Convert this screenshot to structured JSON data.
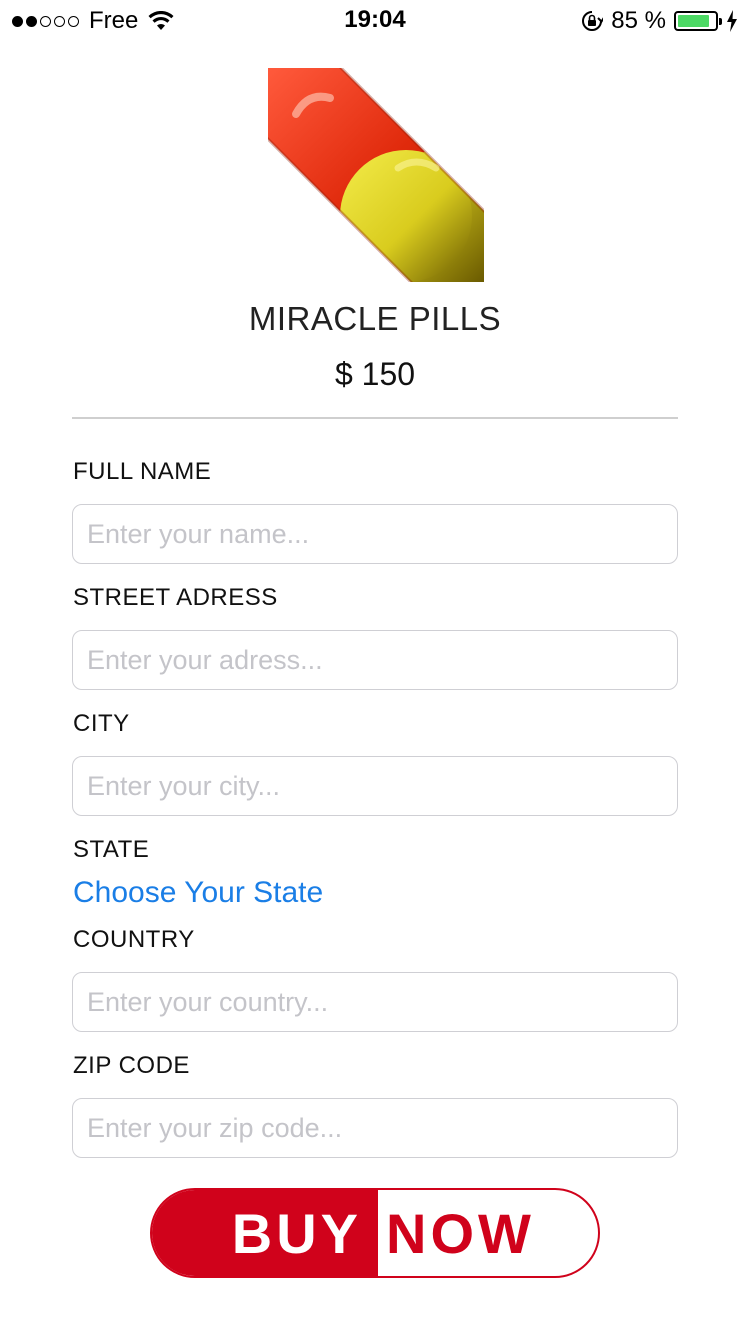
{
  "status_bar": {
    "carrier": "Free",
    "time": "19:04",
    "battery_percent": "85 %",
    "battery_level": 0.85,
    "signal_bars_filled": 2,
    "signal_bars_total": 5
  },
  "product": {
    "name": "MIRACLE PILLS",
    "price": "$ 150",
    "image_icon": "pill-icon"
  },
  "form": {
    "full_name": {
      "label": "FULL NAME",
      "placeholder": "Enter your name...",
      "value": ""
    },
    "street": {
      "label": "STREET ADRESS",
      "placeholder": "Enter your adress...",
      "value": ""
    },
    "city": {
      "label": "CITY",
      "placeholder": "Enter your city...",
      "value": ""
    },
    "state": {
      "label": "STATE",
      "link": "Choose Your State"
    },
    "country": {
      "label": "COUNTRY",
      "placeholder": "Enter your country...",
      "value": ""
    },
    "zip": {
      "label": "ZIP CODE",
      "placeholder": "Enter your zip code...",
      "value": ""
    }
  },
  "buy_button": {
    "left_label": "BUY",
    "right_label": "NOW"
  },
  "colors": {
    "accent_red": "#d0021b",
    "link_blue": "#1a7ee6",
    "battery_green": "#4cd964"
  }
}
